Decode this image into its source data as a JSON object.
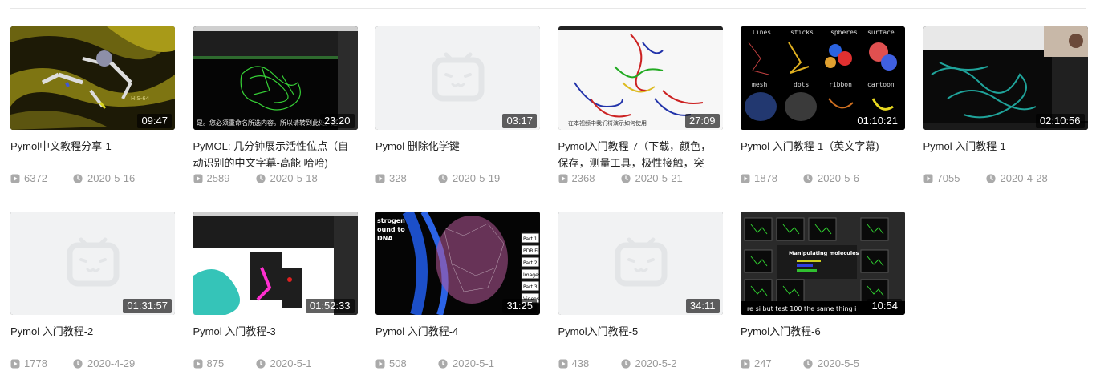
{
  "videos": [
    {
      "title": "Pymol中文教程分享-1",
      "duration": "09:47",
      "plays": "6372",
      "date": "2020-5-16",
      "thumb": "yellow-structure"
    },
    {
      "title": "PyMOL: 几分钟展示活性位点（自动识别的中文字幕-高能 哈哈)",
      "duration": "23:20",
      "plays": "2589",
      "date": "2020-5-18",
      "thumb": "screen-green"
    },
    {
      "title": "Pymol 删除化学键",
      "duration": "03:17",
      "plays": "328",
      "date": "2020-5-19",
      "thumb": "placeholder"
    },
    {
      "title": "Pymol入门教程-7（下载，颜色，保存，测量工具，极性接触，突",
      "duration": "27:09",
      "plays": "2368",
      "date": "2020-5-21",
      "thumb": "trimer-white"
    },
    {
      "title": "Pymol 入门教程-1（英文字幕)",
      "duration": "01:10:21",
      "plays": "1878",
      "date": "2020-5-6",
      "thumb": "styles-grid"
    },
    {
      "title": "Pymol 入门教程-1",
      "duration": "02:10:56",
      "plays": "7055",
      "date": "2020-4-28",
      "thumb": "screen-cyan"
    },
    {
      "title": "Pymol 入门教程-2",
      "duration": "01:31:57",
      "plays": "1778",
      "date": "2020-4-29",
      "thumb": "placeholder"
    },
    {
      "title": "Pymol 入门教程-3",
      "duration": "01:52:33",
      "plays": "875",
      "date": "2020-5-1",
      "thumb": "screen-menu"
    },
    {
      "title": "Pymol 入门教程-4",
      "duration": "31:25",
      "plays": "508",
      "date": "2020-5-1",
      "thumb": "dna-dark"
    },
    {
      "title": "Pymol入门教程-5",
      "duration": "34:11",
      "plays": "438",
      "date": "2020-5-2",
      "thumb": "placeholder"
    },
    {
      "title": "Pymol入门教程-6",
      "duration": "10:54",
      "plays": "247",
      "date": "2020-5-5",
      "thumb": "molecules-grid"
    }
  ],
  "thumb_text": {
    "styles_labels": [
      "lines",
      "sticks",
      "spheres",
      "surface",
      "mesh",
      "dots",
      "ribbon",
      "cartoon"
    ],
    "residue_label": "HIS-64",
    "dna_title_lines": [
      "strogen",
      "ound to",
      "DNA"
    ],
    "dna_menu": [
      "Part 1",
      "PDB File",
      "Part 2",
      "Images",
      "Part 3",
      "Videos"
    ],
    "molecules_heading": "Manipulating molecules",
    "molecules_subtitle": "re si but test 100 the same thing i",
    "green_subtitle": "是。您必须重命名所选内容。所以请转到此处。这",
    "trimer_subtitle": "在本视频中我们将演示如何使用"
  },
  "colors": {
    "placeholder_bg": "#f1f2f3",
    "placeholder_icon": "#e3e5e7",
    "meta": "#999999"
  }
}
